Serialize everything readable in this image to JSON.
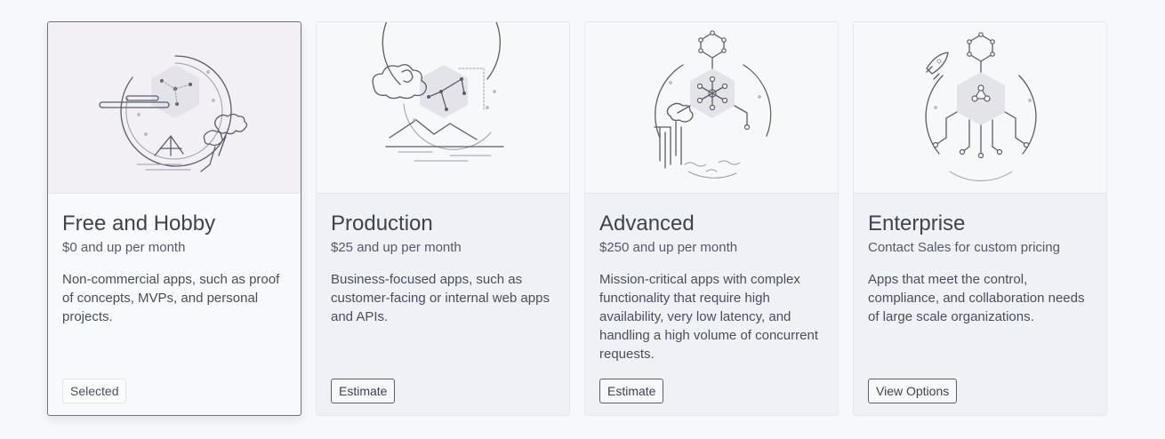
{
  "plans": [
    {
      "title": "Free and Hobby",
      "price": "$0 and up per month",
      "description": "Non-commercial apps, such as proof of concepts, MVPs, and personal projects.",
      "button": "Selected",
      "selected": true,
      "illustration": "campsite-constellation-icon"
    },
    {
      "title": "Production",
      "price": "$25 and up per month",
      "description": "Business-focused apps, such as customer-facing or internal web apps and APIs.",
      "button": "Estimate",
      "selected": false,
      "illustration": "mountains-constellation-icon"
    },
    {
      "title": "Advanced",
      "price": "$250 and up per month",
      "description": "Mission-critical apps with complex functionality that require high availability, very low latency, and handling a high volume of concurrent requests.",
      "button": "Estimate",
      "selected": false,
      "illustration": "waterfall-network-icon"
    },
    {
      "title": "Enterprise",
      "price": "Contact Sales for custom pricing",
      "description": "Apps that meet the control, compliance, and collaboration needs of large scale organizations.",
      "button": "View Options",
      "selected": false,
      "illustration": "rocket-network-icon"
    }
  ],
  "colors": {
    "page_background": "#f7f8fb",
    "card_background": "#eff1f6",
    "selected_card_background": "#f7f9fd",
    "selected_border": "#70737e",
    "text": "#3f4350"
  }
}
